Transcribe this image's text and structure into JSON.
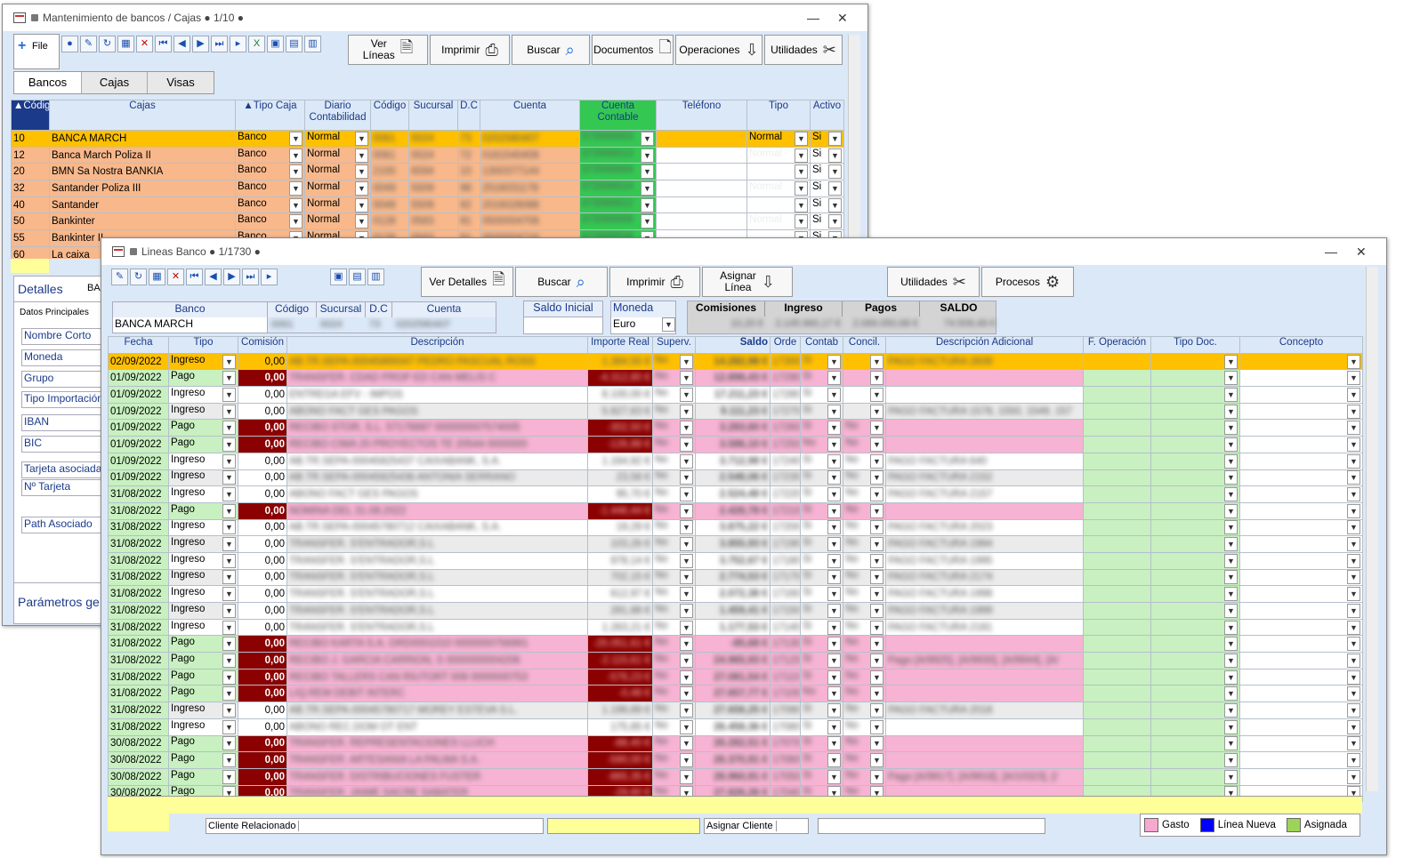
{
  "w1": {
    "title": "Mantenimiento de bancos / Cajas ● 1/10 ●",
    "file_label": "File",
    "btns": [
      {
        "label": "Ver\nLíneas",
        "icon": "doc-search-icon"
      },
      {
        "label": "Imprimir",
        "icon": "printer-icon"
      },
      {
        "label": "Buscar",
        "icon": "magnifier-icon"
      },
      {
        "label": "Documentos",
        "icon": "document-icon"
      },
      {
        "label": "Operaciones",
        "icon": "down-arrow-icon"
      },
      {
        "label": "Utilidades",
        "icon": "tools-icon"
      }
    ],
    "tabs": [
      "Bancos",
      "Cajas",
      "Visas"
    ],
    "headers": [
      "▲Código",
      "Cajas",
      "▲Tipo Caja",
      "Diario Contabilidad",
      "Código",
      "Sucursal",
      "D.C",
      "Cuenta",
      "Cuenta Contable",
      "Teléfono",
      "Tipo",
      "Activo"
    ],
    "rows": [
      [
        "10",
        "BANCA MARCH",
        "Banco",
        "Normal",
        "0061",
        "0024",
        "73",
        "0202580407",
        "572000003",
        "",
        "Normal",
        "Si"
      ],
      [
        "12",
        "Banca March Poliza II",
        "Banco",
        "Normal",
        "0061",
        "0024",
        "72",
        "0161540406",
        "572000013",
        "",
        "Normal",
        "Si"
      ],
      [
        "20",
        "BMN Sa Nostra BANKIA",
        "Banco",
        "Normal",
        "2100",
        "6594",
        "10",
        "1300377144",
        "572000004",
        "",
        "",
        "Si"
      ],
      [
        "32",
        "Santander Poliza III",
        "Banco",
        "Normal",
        "0049",
        "5509",
        "98",
        "2516031178",
        "572000014",
        "",
        "Normal",
        "Si"
      ],
      [
        "40",
        "Santander",
        "Banco",
        "Normal",
        "0049",
        "5509",
        "92",
        "2016028088",
        "572000012",
        "",
        "",
        "Si"
      ],
      [
        "50",
        "Bankinter",
        "Banco",
        "Normal",
        "0128",
        "0583",
        "91",
        "0500004706",
        "572000009",
        "",
        "Normal",
        "Si"
      ],
      [
        "55",
        "Bankinter II",
        "Banco",
        "Normal",
        "0128",
        "0583",
        "91",
        "0500004716",
        "572000016",
        "",
        "",
        "Si"
      ],
      [
        "60",
        "La caixa",
        "",
        "",
        "",
        "",
        "",
        "",
        "",
        "",
        "",
        ""
      ]
    ],
    "details_title": "Detalles",
    "details_extra": "BAI",
    "details_tab": "Datos Principales",
    "fields": [
      "Nombre Corto",
      "Moneda",
      "Grupo",
      "Tipo Importación",
      "IBAN",
      "BIC",
      "Tarjeta asociada",
      "Nº Tarjeta",
      "Path Asociado"
    ],
    "params": "Parámetros ge"
  },
  "w2": {
    "title": "Lineas Banco ● 1/1730 ●",
    "btns": [
      {
        "label": "Ver Detalles",
        "icon": "doc-search-icon"
      },
      {
        "label": "Buscar",
        "icon": "magnifier-icon"
      },
      {
        "label": "Imprimir",
        "icon": "printer-icon"
      },
      {
        "label": "Asignar\nLínea",
        "icon": "down-arrow-icon"
      },
      {
        "label": "Utilidades",
        "icon": "tools-icon"
      },
      {
        "label": "Procesos",
        "icon": "gear-icon"
      }
    ],
    "hdr_labels": {
      "banco": "Banco",
      "codigo": "Código",
      "sucursal": "Sucursal",
      "dc": "D.C",
      "cuenta": "Cuenta",
      "saldo_inicial": "Saldo Inicial",
      "moneda": "Moneda",
      "comisiones": "Comisiones",
      "ingreso": "Ingreso",
      "pagos": "Pagos",
      "saldo": "SALDO"
    },
    "hdr_values": {
      "banco": "BANCA MARCH",
      "codigo": "0061",
      "sucursal": "0024",
      "dc": "73",
      "cuenta": "0202580407",
      "moneda": "Euro",
      "comisiones": "10,20 €",
      "ingreso": "2.145.960,17 €",
      "pagos": "2.069.050,68 €",
      "saldo": "74.509,49 €"
    },
    "headers": [
      "Fecha",
      "Tipo",
      "Comisión",
      "Descripción",
      "Importe Real",
      "Superv.",
      "Saldo",
      "Orde",
      "Contab",
      "Concil.",
      "Descripción Adicional",
      "F. Operación",
      "Tipo Doc.",
      "Concepto"
    ],
    "rows": [
      [
        "02/09/2022",
        "Ingreso",
        "0,00",
        "AB.TR.SEPA-00045869347 PEDRO PASCUAL ROSS",
        "1.384,55 €",
        "No",
        "14.282,98 €",
        "17300",
        "Si",
        "",
        "PAGO FACTURA 2839"
      ],
      [
        "01/09/2022",
        "Pago",
        "0,00",
        "TRANSFER. CDAD PROP ED CAN MELIS C",
        "-4.312,80 €",
        "No",
        "12.898,43 €",
        "17290",
        "Si",
        "",
        ""
      ],
      [
        "01/09/2022",
        "Ingreso",
        "0,00",
        "ENTREGA EFV - IMPOS",
        "8.100,00 €",
        "No",
        "17.211,23 €",
        "17280",
        "Si",
        "",
        ""
      ],
      [
        "01/09/2022",
        "Ingreso",
        "0,00",
        "ABONO FACT GES PAGOS",
        "5.827,63 €",
        "No",
        "9.111,23 €",
        "17270",
        "Si",
        "",
        "PAGO FACTURA 1578, 1550, 1549, 157"
      ],
      [
        "01/09/2022",
        "Pago",
        "0,00",
        "RECIBO STOR, S.L. 57176687 000000007574005",
        "-302,50 €",
        "No",
        "3.283,60 €",
        "17260",
        "Si",
        "No",
        ""
      ],
      [
        "01/09/2022",
        "Pago",
        "0,00",
        "RECIBO CIMA 20 PROYECTOS TE 20544 0000000",
        "-126,88 €",
        "No",
        "3.586,10 €",
        "17250",
        "No",
        "No",
        ""
      ],
      [
        "01/09/2022",
        "Ingreso",
        "0,00",
        "AB.TR.SEPA-00045825437 CAIXABANK, S.A.",
        "1.164,92 €",
        "No",
        "3.712,98 €",
        "17240",
        "Si",
        "No",
        "PAGO FACTURA 640"
      ],
      [
        "01/09/2022",
        "Ingreso",
        "0,00",
        "AB.TR.SEPA-00045825436 ANTONIA SERRANO",
        "23,58 €",
        "No",
        "2.548,06 €",
        "17230",
        "Si",
        "No",
        "PAGO FACTURA 2152"
      ],
      [
        "31/08/2022",
        "Ingreso",
        "0,00",
        "ABONO FACT GES PAGOS",
        "95,70 €",
        "No",
        "2.524,48 €",
        "17220",
        "Si",
        "No",
        "PAGO FACTURA 2157"
      ],
      [
        "31/08/2022",
        "Pago",
        "0,00",
        "NOMINA DEL 31.08.2022",
        "-1.446,44 €",
        "No",
        "2.428,78 €",
        "17210",
        "Si",
        "No",
        ""
      ],
      [
        "31/08/2022",
        "Ingreso",
        "0,00",
        "AB.TR.SEPA-00045780712 CAIXABANK, S.A.",
        "19,29 €",
        "No",
        "3.875,22 €",
        "17200",
        "Si",
        "No",
        "PAGO FACTURA 2023"
      ],
      [
        "31/08/2022",
        "Ingreso",
        "0,00",
        "TRANSFER. S'ENTRADOR,S.L",
        "103,26 €",
        "No",
        "3.855,93 €",
        "17190",
        "Si",
        "No",
        "PAGO FACTURA 1994"
      ],
      [
        "31/08/2022",
        "Ingreso",
        "0,00",
        "TRANSFER. S'ENTRADOR,S.L",
        "978,14 €",
        "No",
        "3.752,67 €",
        "17180",
        "Si",
        "No",
        "PAGO FACTURA 1995"
      ],
      [
        "31/08/2022",
        "Ingreso",
        "0,00",
        "TRANSFER. S'ENTRADOR,S.L",
        "702,15 €",
        "No",
        "2.774,53 €",
        "17170",
        "Si",
        "No",
        "PAGO FACTURA 2174"
      ],
      [
        "31/08/2022",
        "Ingreso",
        "0,00",
        "TRANSFER. S'ENTRADOR,S.L",
        "612,97 €",
        "No",
        "2.072,38 €",
        "17160",
        "Si",
        "No",
        "PAGO FACTURA 1998"
      ],
      [
        "31/08/2022",
        "Ingreso",
        "0,00",
        "TRANSFER. S'ENTRADOR,S.L",
        "281,88 €",
        "No",
        "1.459,41 €",
        "17150",
        "Si",
        "No",
        "PAGO FACTURA 1999"
      ],
      [
        "31/08/2022",
        "Ingreso",
        "0,00",
        "TRANSFER. S'ENTRADOR,S.L",
        "1.263,21 €",
        "No",
        "1.177,53 €",
        "17140",
        "Si",
        "No",
        "PAGO FACTURA 2181"
      ],
      [
        "31/08/2022",
        "Pago",
        "0,00",
        "RECIBO KARTA S.A. ORD0001010 0000000756991",
        "-25.051,61 €",
        "No",
        "-85,68 €",
        "17130",
        "Si",
        "No",
        ""
      ],
      [
        "31/08/2022",
        "Pago",
        "0,00",
        "RECIBO J. GARCIA CARRION, S 0000000004206",
        "-2.115,61 €",
        "No",
        "24.965,93 €",
        "17120",
        "Si",
        "No",
        "Pago [A/9925], [A/9930], [A/9944], [A/"
      ],
      [
        "31/08/2022",
        "Pago",
        "0,00",
        "RECIBO TALLERS CAN RIUTORT 008 0000000753",
        "-576,23 €",
        "No",
        "27.081,54 €",
        "17110",
        "Si",
        "No",
        ""
      ],
      [
        "31/08/2022",
        "Pago",
        "0,00",
        "LIQ.REM DEBIT INTERC",
        "-0,48 €",
        "No",
        "27.657,77 €",
        "17100",
        "No",
        "No",
        ""
      ],
      [
        "31/08/2022",
        "Ingreso",
        "0,00",
        "AB.TR.SEPA-00045780717 MOREY ESTEVA S.L.",
        "1.199,89 €",
        "No",
        "27.658,25 €",
        "17090",
        "Si",
        "No",
        "PAGO FACTURA 2018"
      ],
      [
        "31/08/2022",
        "Ingreso",
        "0,00",
        "ABONO REC.DOM OT ENT",
        "175,85 €",
        "No",
        "26.458,36 €",
        "17080",
        "Si",
        "No",
        ""
      ],
      [
        "30/08/2022",
        "Pago",
        "0,00",
        "TRANSFER. REPRESENTACIONES LLUCH",
        "-88,40 €",
        "No",
        "26.282,51 €",
        "17070",
        "Si",
        "No",
        ""
      ],
      [
        "30/08/2022",
        "Pago",
        "0,00",
        "TRANSFER. ARTESANIA LA PALMA S.A.",
        "-590,00 €",
        "No",
        "26.370,91 €",
        "17060",
        "Si",
        "No",
        ""
      ],
      [
        "30/08/2022",
        "Pago",
        "0,00",
        "TRANSFER. DISTRIBUCIONES FUSTER",
        "-865,35 €",
        "No",
        "26.960,91 €",
        "17050",
        "Si",
        "No",
        "Pago [A/9917], [A/9918], [A/10323], [/"
      ],
      [
        "30/08/2022",
        "Pago",
        "0,00",
        "TRANSFER. JAIME SACRE SABATER",
        "-29,80 €",
        "No",
        "27.826,26 €",
        "17040",
        "Si",
        "No",
        ""
      ]
    ],
    "bottom": {
      "cliente": "Cliente Relacionado",
      "asignar": "Asignar Cliente"
    },
    "legend": [
      {
        "label": "Gasto",
        "color": "#f7a8cf"
      },
      {
        "label": "Línea Nueva",
        "color": "#0000ff"
      },
      {
        "label": "Asignada",
        "color": "#9ed35a"
      }
    ]
  },
  "colors": {
    "yellow": "#ffc000",
    "orange": "#f8b88b",
    "green": "#34c853",
    "pink": "#f7b3d3",
    "darkred": "#8b0000",
    "lightgreen": "#c8f0c0",
    "hdrbg": "#dbe8f7"
  }
}
